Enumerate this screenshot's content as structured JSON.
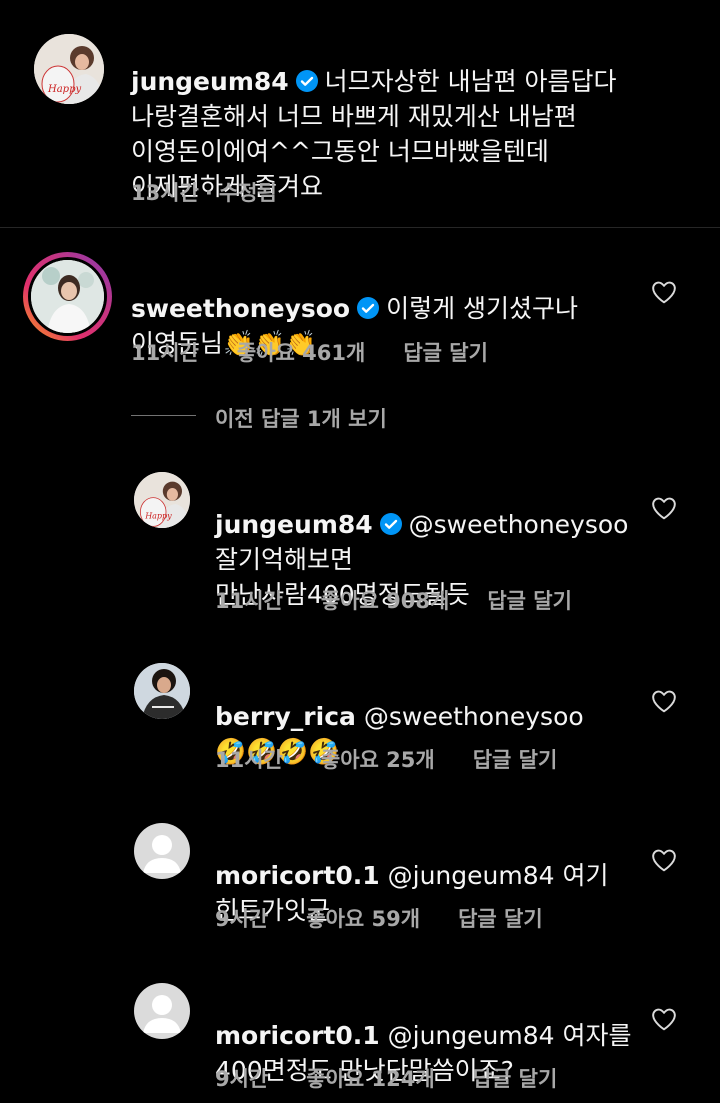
{
  "main_comment": {
    "username": "jungeum84",
    "text": "너므자상한 내남편 아름답다\n나랑결혼해서 너므 바쁘게 재밌게산 내남편\n이영돈이에여^^그동안 너므바빴을텐데\n이제편하게 즐겨요",
    "time": "13시간",
    "edited": "수정됨"
  },
  "comment": {
    "username": "sweethoneysoo",
    "text": "이렇게 생기셨구나\n이영돈님👏👏👏",
    "time": "11시간",
    "likes": "좋아요 461개",
    "reply": "답글 달기"
  },
  "view_previous": "이전 답글 1개 보기",
  "replies": [
    {
      "username": "jungeum84",
      "mention": "@sweethoneysoo",
      "text": "잘기억해보면\n만난사람400명정도될듯",
      "time": "11시간",
      "likes": "좋아요 908개",
      "reply": "답글 달기"
    },
    {
      "username": "berry_rica",
      "mention": "@sweethoneysoo",
      "text": "🤣🤣🤣🤣",
      "time": "11시간",
      "likes": "좋아요 25개",
      "reply": "답글 달기"
    },
    {
      "username": "moricort0.1",
      "mention": "@jungeum84",
      "text_a": "여기",
      "text_b": "힌트가잇군",
      "time": "9시간",
      "likes": "좋아요 59개",
      "reply": "답글 달기"
    },
    {
      "username": "moricort0.1",
      "mention": "@jungeum84",
      "text_a": "여자를",
      "text_b": "400면정도 만낫단말씀이죠?",
      "time": "9시간",
      "likes": "좋아요 124개",
      "reply": "답글 달기"
    }
  ],
  "colors": {
    "verified": "#0095f6",
    "muted": "#a8a8a8",
    "background": "#000000"
  }
}
